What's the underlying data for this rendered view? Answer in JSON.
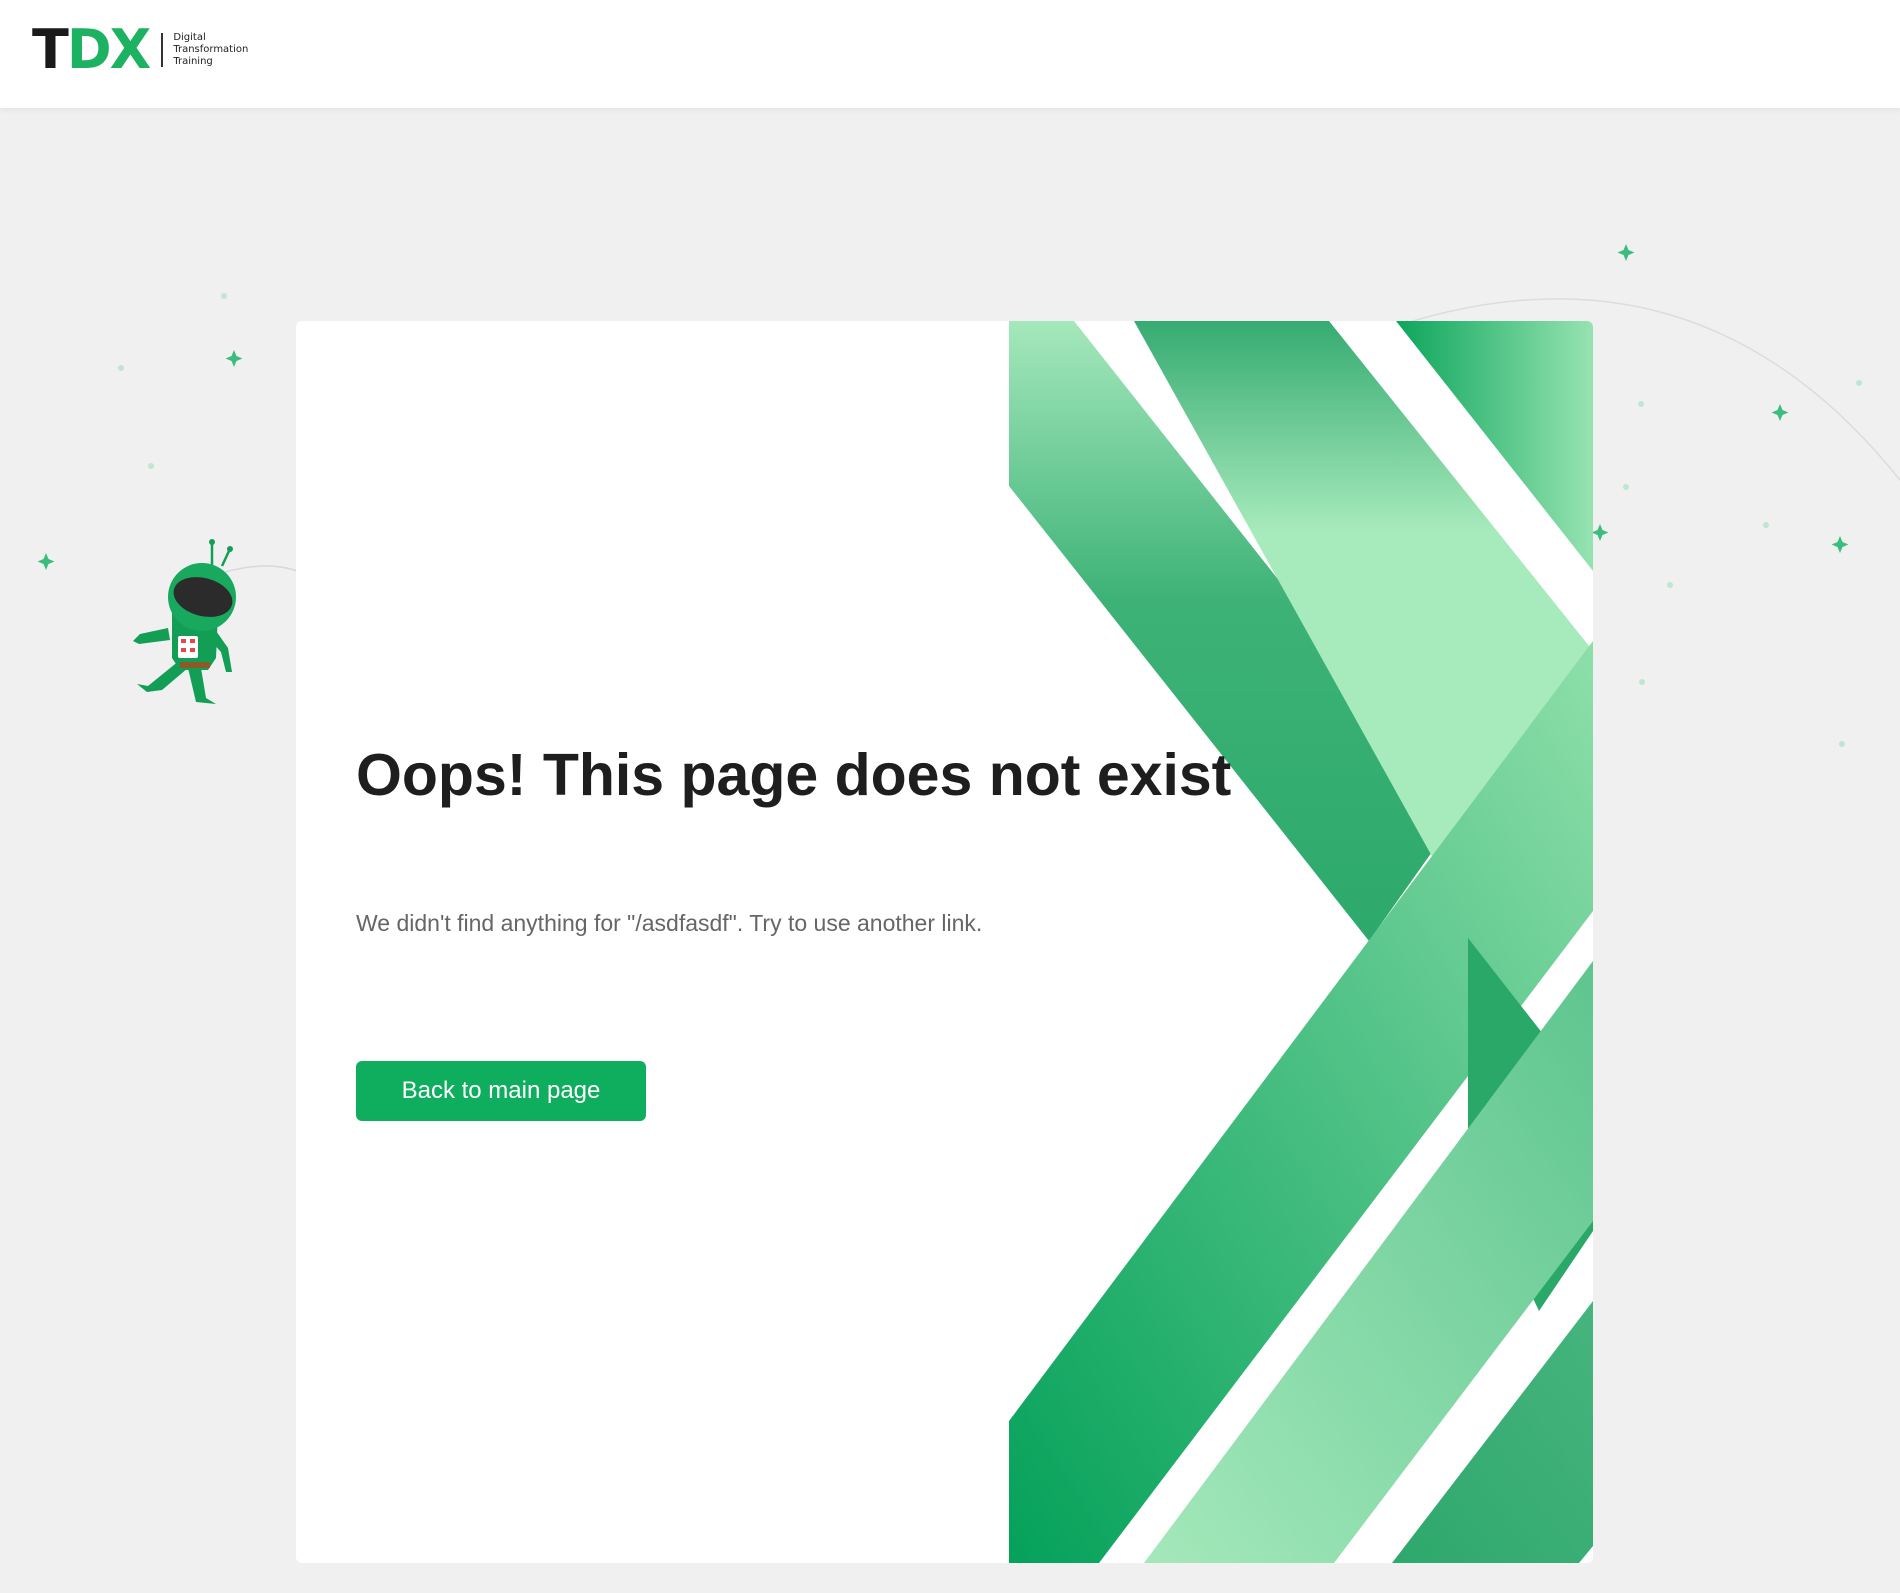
{
  "header": {
    "logo": {
      "mark_t": "T",
      "mark_dx": "DX",
      "tagline_lines": [
        "Digital",
        "Transformation",
        "Training"
      ]
    }
  },
  "error": {
    "title": "Oops! This page does not exist",
    "message": "We didn't find anything for \"/asdfasdf\". Try to use another link.",
    "back_button_label": "Back to main page"
  },
  "colors": {
    "brand_green": "#0fad5e",
    "background": "#f0f0f1",
    "title_text": "#1e1e1e",
    "body_text": "#666666"
  },
  "icons": {
    "mascot": "astronaut-mascot-icon",
    "stars": "sparkle-star-icon"
  }
}
